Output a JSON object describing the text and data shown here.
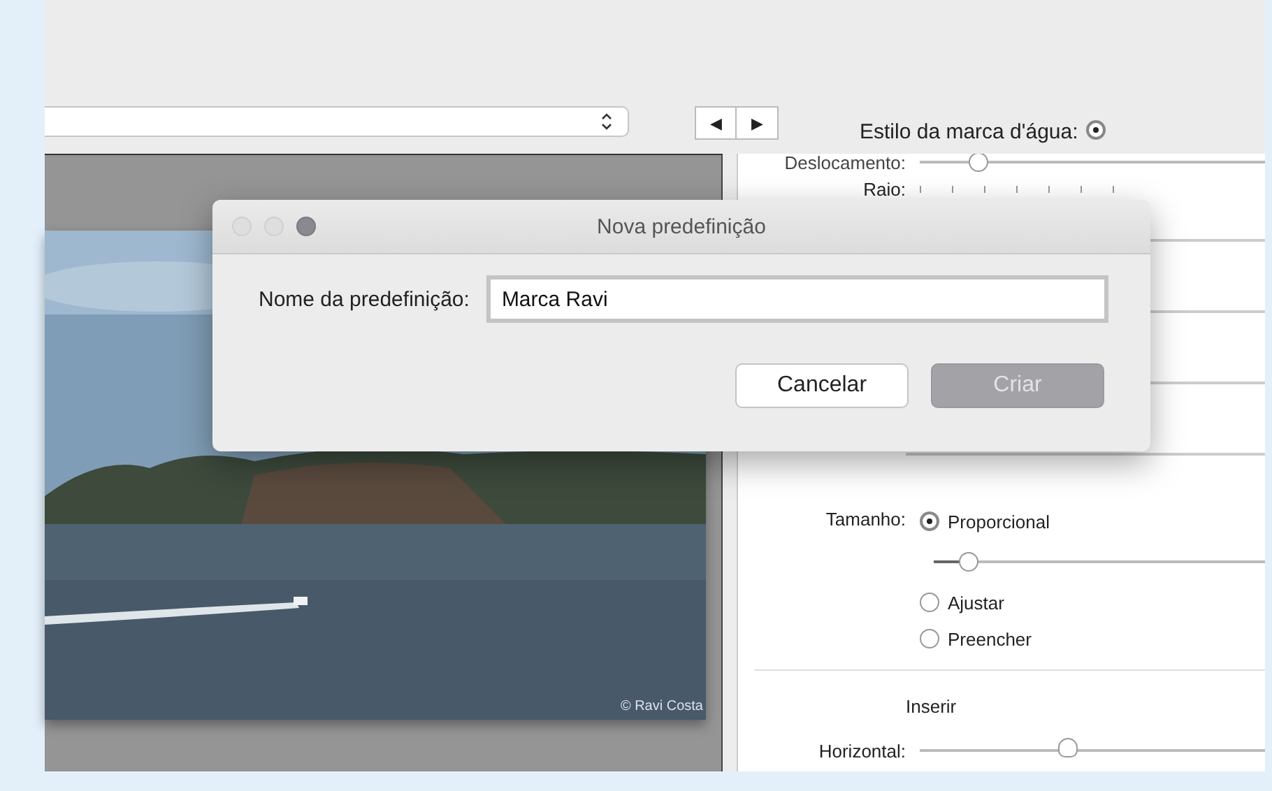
{
  "toolbar": {
    "nav_buttons": [
      "◀",
      "▶"
    ],
    "watermark_style": {
      "label": "Estilo da marca d'água:",
      "selected": true
    }
  },
  "preview": {
    "watermark_text": "© Ravi Costa"
  },
  "settings": {
    "deslocamento": {
      "label": "Deslocamento:",
      "level": 0.17
    },
    "raio": {
      "label": "Raio:"
    },
    "tamanho": {
      "label": "Tamanho:",
      "items": [
        {
          "kind": "radio",
          "label": "Proporcional",
          "selected": true
        },
        {
          "kind": "slider",
          "level": 0.1
        },
        {
          "kind": "radio",
          "label": "Ajustar",
          "selected": false
        },
        {
          "kind": "radio",
          "label": "Preencher",
          "selected": false
        }
      ]
    },
    "inserir": {
      "heading": "Inserir",
      "horizontal": {
        "label": "Horizontal:",
        "level": 0.43
      }
    }
  },
  "dialog": {
    "title": "Nova predefinição",
    "field_label": "Nome da predefinição:",
    "field_value": "Marca Ravi",
    "buttons": [
      {
        "label": "Cancelar",
        "disabled": false
      },
      {
        "label": "Criar",
        "disabled": true
      }
    ]
  }
}
